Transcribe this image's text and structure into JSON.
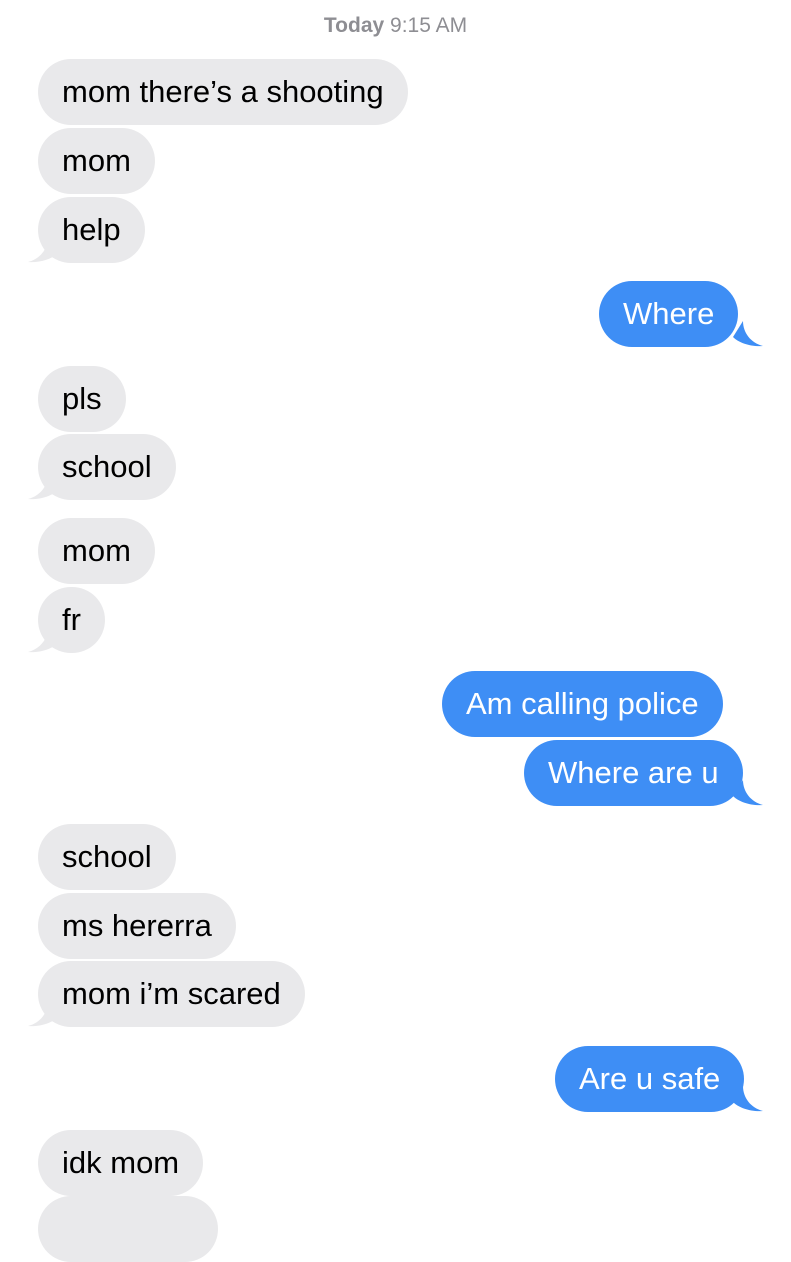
{
  "timestamp": {
    "day": "Today",
    "time": "9:15 AM"
  },
  "colors": {
    "incoming_bubble": "#e9e9eb",
    "outgoing_bubble": "#3e8ef5",
    "timestamp_text": "#8e8e93"
  },
  "messages": [
    {
      "sender": "them",
      "text": "mom there’s a shooting"
    },
    {
      "sender": "them",
      "text": "mom"
    },
    {
      "sender": "them",
      "text": "help"
    },
    {
      "sender": "me",
      "text": "Where"
    },
    {
      "sender": "them",
      "text": "pls"
    },
    {
      "sender": "them",
      "text": "school"
    },
    {
      "sender": "them",
      "text": "mom"
    },
    {
      "sender": "them",
      "text": "fr"
    },
    {
      "sender": "me",
      "text": "Am calling police"
    },
    {
      "sender": "me",
      "text": "Where are u"
    },
    {
      "sender": "them",
      "text": "school"
    },
    {
      "sender": "them",
      "text": "ms hererra"
    },
    {
      "sender": "them",
      "text": "mom i’m scared"
    },
    {
      "sender": "me",
      "text": "Are u safe"
    },
    {
      "sender": "them",
      "text": "idk mom"
    }
  ]
}
